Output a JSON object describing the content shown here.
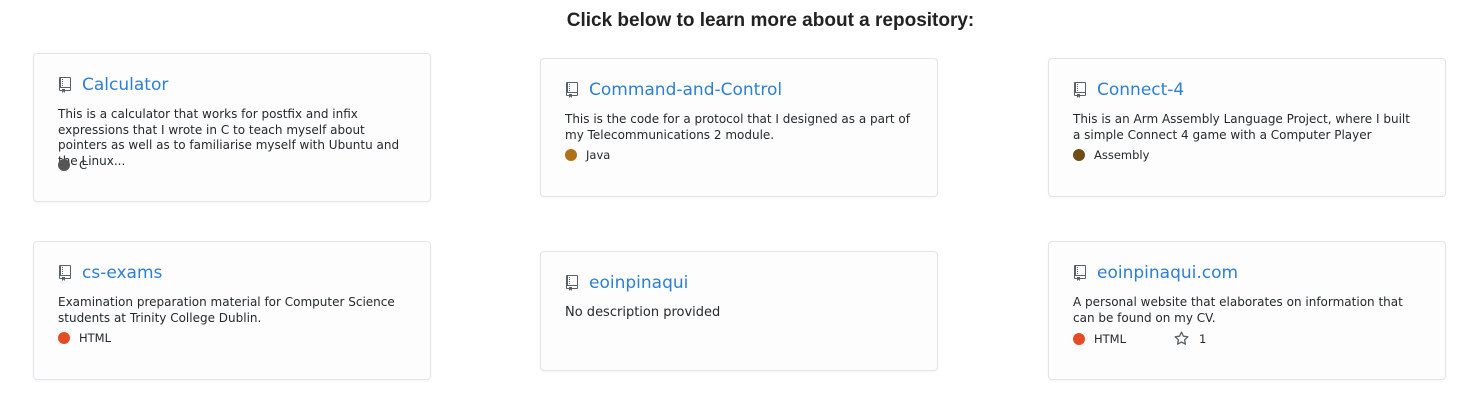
{
  "heading": "Click below to learn more about a repository:",
  "repos": [
    {
      "name": "Calculator",
      "description": "This is a calculator that works for postfix and infix expressions that I wrote in C to teach myself about pointers as well as to familiarise myself with Ubuntu and the Linux...",
      "language": "C",
      "language_color": "#555555"
    },
    {
      "name": "Command-and-Control",
      "description": "This is the code for a protocol that I designed as a part of my Telecommunications 2 module.",
      "language": "Java",
      "language_color": "#b07219"
    },
    {
      "name": "Connect-4",
      "description": "This is an Arm Assembly Language Project, where I built a simple Connect 4 game with a Computer Player",
      "language": "Assembly",
      "language_color": "#6e4c13"
    },
    {
      "name": "cs-exams",
      "description": "Examination preparation material for Computer Science students at Trinity College Dublin.",
      "language": "HTML",
      "language_color": "#e34c26"
    },
    {
      "name": "eoinpinaqui",
      "description": "No description provided"
    },
    {
      "name": "eoinpinaqui.com",
      "description": "A personal website that elaborates on information that can be found on my CV.",
      "language": "HTML",
      "language_color": "#e34c26",
      "stars": "1"
    }
  ],
  "icons": {
    "repo": "repo-icon",
    "star": "star-icon"
  },
  "colors": {
    "link": "#2d7fd3"
  }
}
